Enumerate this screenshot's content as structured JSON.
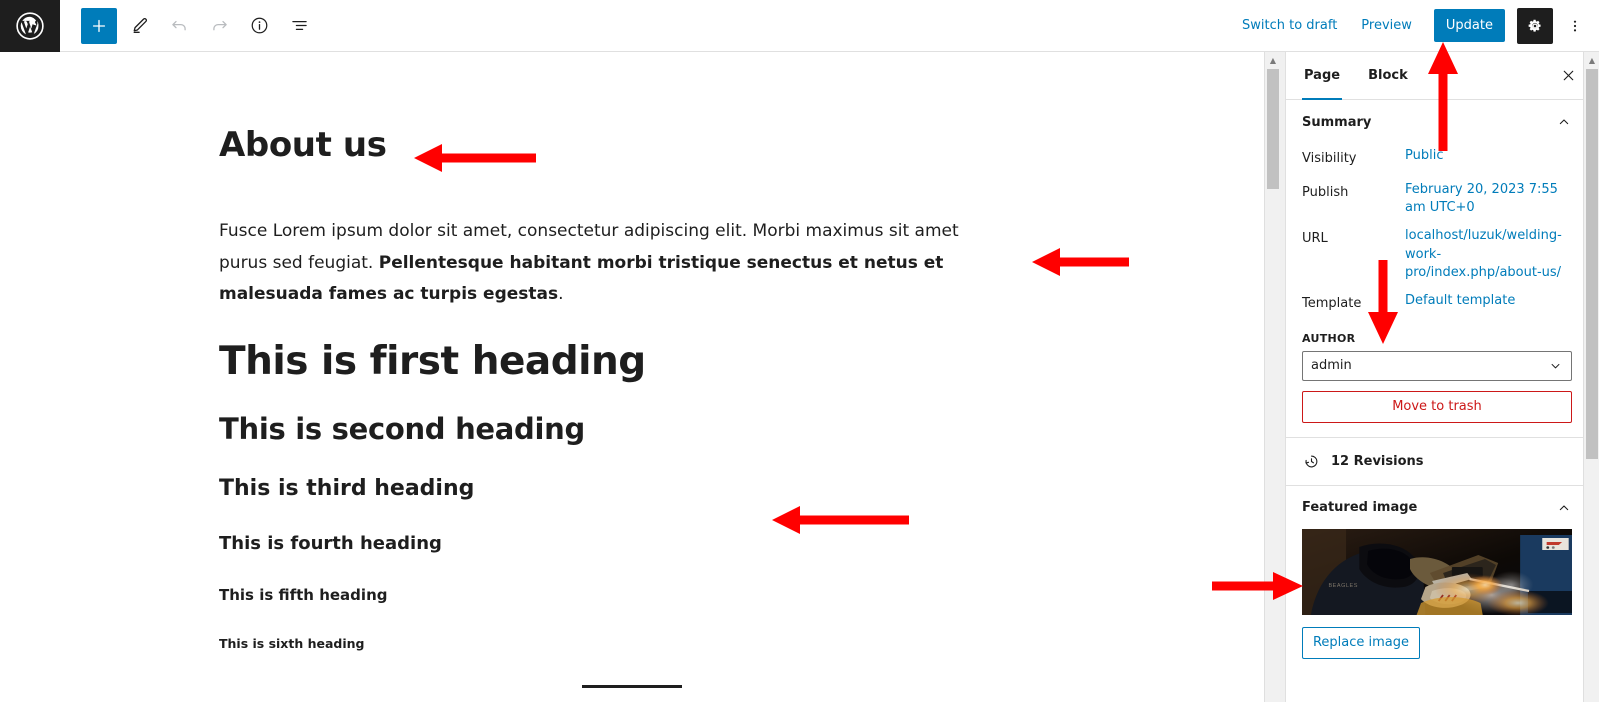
{
  "app": {
    "logo_icon": "wordpress-logo-icon"
  },
  "toolbar": {
    "add_block_label": "+",
    "add_block_icon": "plus-icon",
    "tools_icon": "pencil-icon",
    "undo_icon": "undo-arrow-icon",
    "redo_icon": "redo-arrow-icon",
    "details_icon": "info-circle-icon",
    "list_view_icon": "list-view-icon",
    "switch_to_draft": "Switch to draft",
    "preview": "Preview",
    "update": "Update",
    "settings_icon": "gear-icon",
    "more_icon": "kebab-menu-icon",
    "accent_color": "#007cba",
    "dark_color": "#1e1e1e"
  },
  "canvas": {
    "page_title": "About us",
    "paragraph": {
      "lead": "Fusce Lorem ipsum dolor sit amet, consectetur adipiscing elit. Morbi maximus sit amet purus sed feugiat. ",
      "bold": "Pellentesque habitant morbi tristique senectus et netus et malesuada fames ac turpis egestas",
      "tail": "."
    },
    "headings": {
      "h1": "This is first heading",
      "h2": "This is second heading",
      "h3": "This is third heading",
      "h4": "This is fourth heading",
      "h5": "This is fifth heading",
      "h6": "This is sixth heading"
    },
    "separator_name": "separator-block"
  },
  "sidebar": {
    "tabs": [
      {
        "label": "Page",
        "active": true
      },
      {
        "label": "Block",
        "active": false
      }
    ],
    "close_icon": "close-x-icon",
    "summary": {
      "title": "Summary",
      "collapse_icon": "chevron-up-icon",
      "rows": [
        {
          "label": "Visibility",
          "value": "Public"
        },
        {
          "label": "Publish",
          "value": "February 20, 2023 7:55 am UTC+0"
        },
        {
          "label": "URL",
          "value": "localhost/luzuk/welding-work-pro/index.php/about-us/"
        },
        {
          "label": "Template",
          "value": "Default template"
        }
      ],
      "author_label": "AUTHOR",
      "author_value": "admin",
      "author_chevron_icon": "chevron-down-icon",
      "move_to_trash": "Move to trash",
      "trash_color": "#cc1818"
    },
    "revisions": {
      "label": "12 Revisions",
      "icon": "revision-clock-icon"
    },
    "featured_image": {
      "title": "Featured image",
      "collapse_icon": "chevron-up-icon",
      "image_alt": "welder-working-photo",
      "replace_label": "Replace image"
    }
  },
  "annotations": {
    "color": "#ff0000",
    "arrows": [
      {
        "name": "arrow-to-page-title",
        "direction": "left"
      },
      {
        "name": "arrow-to-paragraph",
        "direction": "left"
      },
      {
        "name": "arrow-to-headings",
        "direction": "left"
      },
      {
        "name": "arrow-to-update-button",
        "direction": "up"
      },
      {
        "name": "arrow-to-template-row",
        "direction": "down"
      },
      {
        "name": "arrow-to-featured-image",
        "direction": "right"
      }
    ]
  }
}
